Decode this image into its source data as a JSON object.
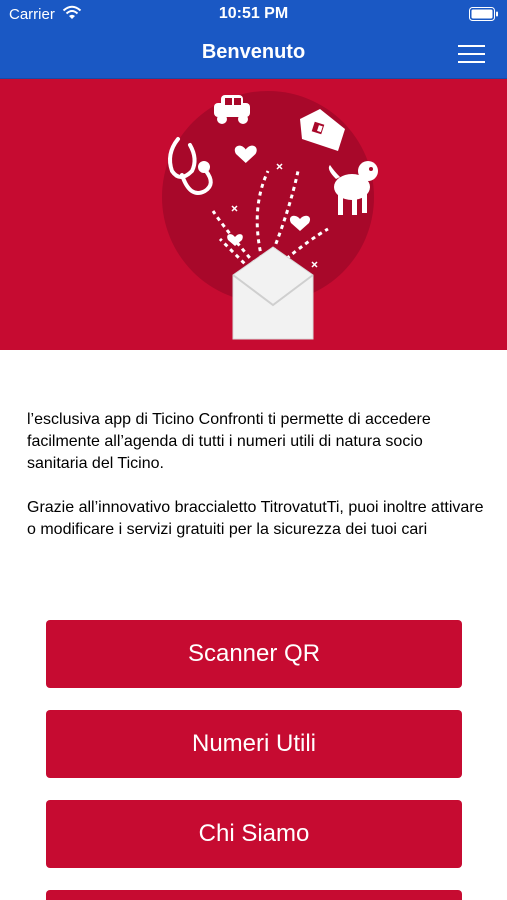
{
  "status_bar": {
    "carrier": "Carrier",
    "time": "10:51 PM"
  },
  "navbar": {
    "title": "Benvenuto"
  },
  "intro": {
    "paragraph1": "l’esclusiva app di Ticino Confronti ti permette di accedere facilmente all’agenda di tutti i numeri utili di natura socio sanitaria del Ticino.",
    "paragraph2": "Grazie all’innovativo braccialetto TitrovatutTi, puoi inoltre attivare o modificare i servizi gratuiti per la sicurezza dei tuoi cari"
  },
  "buttons": [
    {
      "label": "Scanner QR"
    },
    {
      "label": "Numeri Utili"
    },
    {
      "label": "Chi Siamo"
    },
    {
      "label": ""
    }
  ],
  "colors": {
    "nav_blue": "#1a58c4",
    "brand_red": "#c60b31",
    "hero_circle": "#a8082a"
  }
}
